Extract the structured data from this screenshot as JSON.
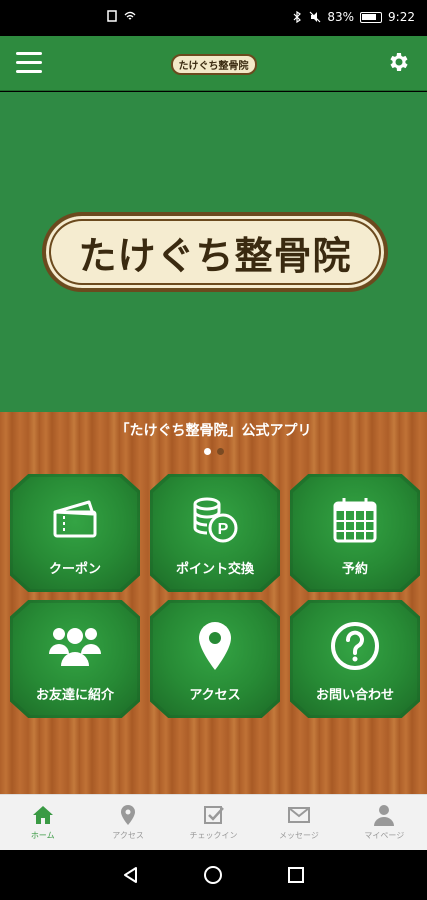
{
  "status_bar": {
    "battery_text": "83%",
    "time": "9:22"
  },
  "header": {
    "logo_text": "たけぐち整骨院"
  },
  "hero": {
    "logo_text": "たけぐち整骨院",
    "slide_count": 2,
    "active_slide": 0
  },
  "subtitle": "「たけぐち整骨院」公式アプリ",
  "tiles": [
    {
      "label": "クーポン",
      "icon": "coupon-icon"
    },
    {
      "label": "ポイント交換",
      "icon": "points-icon"
    },
    {
      "label": "予約",
      "icon": "calendar-icon"
    },
    {
      "label": "お友達に紹介",
      "icon": "friends-icon"
    },
    {
      "label": "アクセス",
      "icon": "location-pin-icon"
    },
    {
      "label": "お問い合わせ",
      "icon": "question-icon"
    }
  ],
  "bottom_nav": [
    {
      "label": "ホーム",
      "icon": "home-icon",
      "active": true
    },
    {
      "label": "アクセス",
      "icon": "location-pin-icon",
      "active": false
    },
    {
      "label": "チェックイン",
      "icon": "checkin-icon",
      "active": false
    },
    {
      "label": "メッセージ",
      "icon": "envelope-icon",
      "active": false
    },
    {
      "label": "マイページ",
      "icon": "user-icon",
      "active": false
    }
  ],
  "colors": {
    "header_green": "#2e8b3f",
    "hero_green": "#2f8a44",
    "tile_green": "#278a35",
    "wood": "#b0612a",
    "active_nav": "#3a9a44",
    "inactive_nav": "#999999"
  }
}
